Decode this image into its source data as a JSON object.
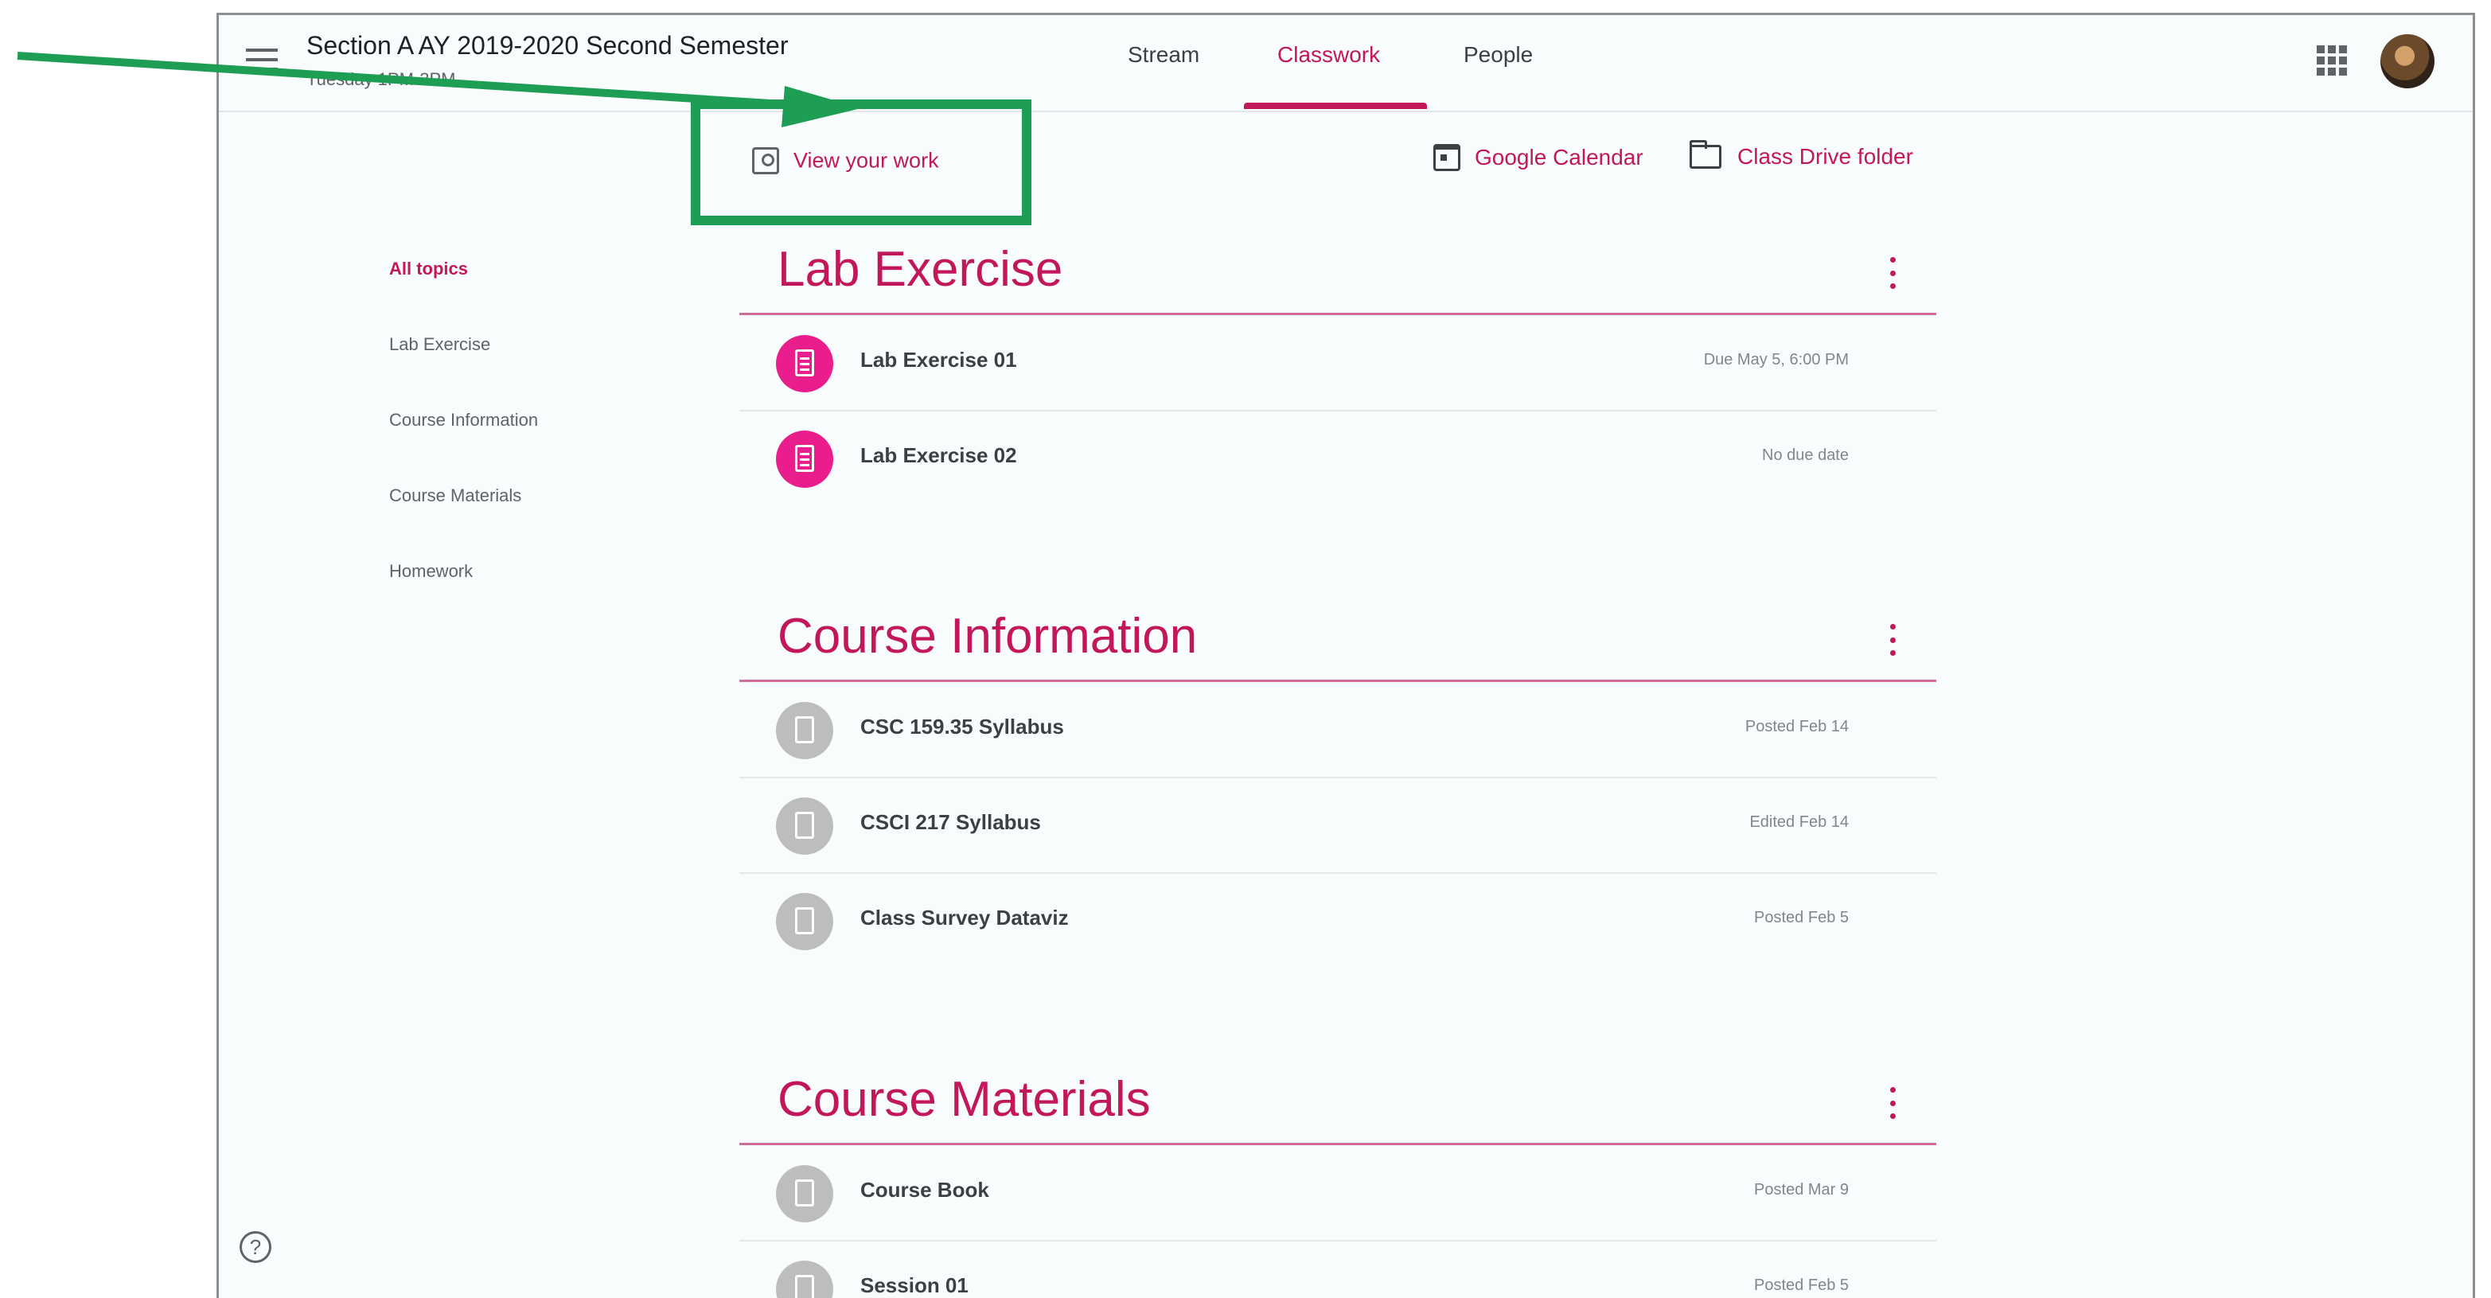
{
  "header": {
    "class_title": "Section A AY 2019-2020 Second Semester",
    "class_subtitle": "Tuesday 1PM-3PM",
    "tabs": [
      {
        "label": "Stream"
      },
      {
        "label": "Classwork"
      },
      {
        "label": "People"
      }
    ],
    "active_tab": "Classwork",
    "menu_icon": "menu-icon",
    "apps_icon": "apps-grid-icon",
    "avatar_icon": "user-avatar"
  },
  "toolbar": {
    "view_work_label": "View your work",
    "google_calendar_label": "Google Calendar",
    "drive_folder_label": "Class Drive folder"
  },
  "topics": [
    {
      "label": "All topics",
      "active": true
    },
    {
      "label": "Lab Exercise",
      "active": false
    },
    {
      "label": "Course Information",
      "active": false
    },
    {
      "label": "Course Materials",
      "active": false
    },
    {
      "label": "Homework",
      "active": false
    }
  ],
  "sections": [
    {
      "title": "Lab Exercise",
      "items": [
        {
          "name": "Lab Exercise 01",
          "meta": "Due May 5, 6:00 PM",
          "icon": "assignment-icon"
        },
        {
          "name": "Lab Exercise 02",
          "meta": "No due date",
          "icon": "assignment-icon"
        }
      ]
    },
    {
      "title": "Course Information",
      "items": [
        {
          "name": "CSC 159.35 Syllabus",
          "meta": "Posted Feb 14",
          "icon": "material-icon"
        },
        {
          "name": "CSCI 217 Syllabus",
          "meta": "Edited Feb 14",
          "icon": "material-icon"
        },
        {
          "name": "Class Survey Dataviz",
          "meta": "Posted Feb 5",
          "icon": "material-icon"
        }
      ]
    },
    {
      "title": "Course Materials",
      "items": [
        {
          "name": "Course Book",
          "meta": "Posted Mar 9",
          "icon": "material-icon"
        },
        {
          "name": "Session 01",
          "meta": "Posted Feb 5",
          "icon": "material-icon"
        }
      ]
    }
  ],
  "help": {
    "icon": "help-icon"
  },
  "colors": {
    "accent": "#c2185b",
    "assignment_circle": "#e91e8c",
    "material_circle": "#bdbdbd",
    "annotation_green": "#1e9e55"
  }
}
